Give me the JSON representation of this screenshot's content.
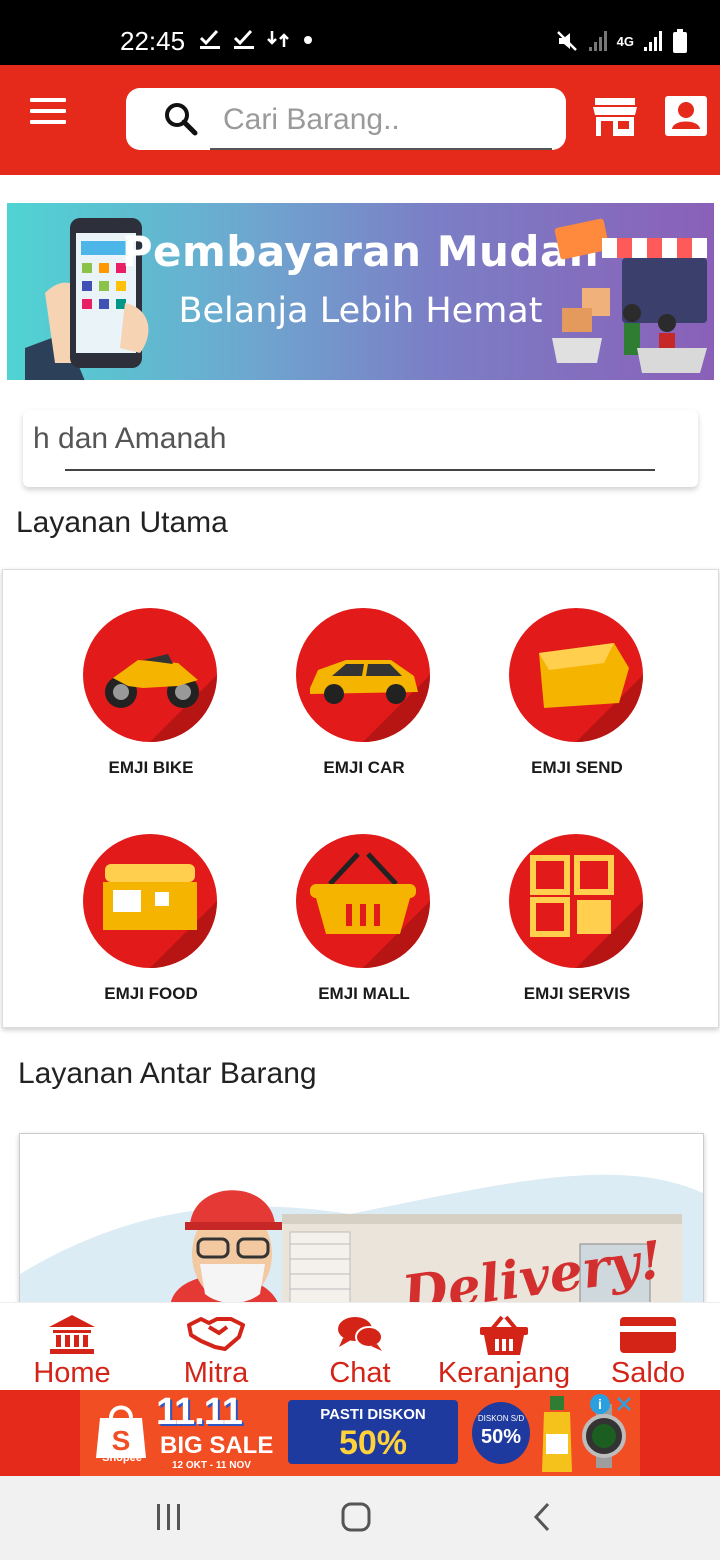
{
  "status_bar": {
    "time": "22:45",
    "network": "4G",
    "icons": [
      "check-download-icon",
      "check-download-icon",
      "sync-icon",
      "dot-icon",
      "mute-icon",
      "signal-icon",
      "signal-icon",
      "battery-icon"
    ]
  },
  "app_bar": {
    "search_placeholder": "Cari Barang..",
    "icons": [
      "menu-icon",
      "search-icon",
      "store-icon",
      "profile-icon"
    ]
  },
  "banner": {
    "title": "Pembayaran Mudah",
    "subtitle": "Belanja Lebih Hemat"
  },
  "marquee": {
    "text": "h dan Amanah"
  },
  "sections": {
    "main_services": "Layanan Utama",
    "delivery": "Layanan Antar Barang"
  },
  "services": [
    {
      "label": "EMJI BIKE",
      "icon": "motorbike-icon"
    },
    {
      "label": "EMJI CAR",
      "icon": "car-icon"
    },
    {
      "label": "EMJI SEND",
      "icon": "package-icon"
    },
    {
      "label": "EMJI FOOD",
      "icon": "food-stall-icon"
    },
    {
      "label": "EMJI MALL",
      "icon": "basket-icon"
    },
    {
      "label": "EMJI SERVIS",
      "icon": "grid-icon"
    }
  ],
  "delivery_card": {
    "sign_text": "Delivery!"
  },
  "bottom_nav": [
    {
      "label": "Home",
      "icon": "bank-icon"
    },
    {
      "label": "Mitra",
      "icon": "handshake-icon"
    },
    {
      "label": "Chat",
      "icon": "chat-icon"
    },
    {
      "label": "Keranjang",
      "icon": "basket-icon"
    },
    {
      "label": "Saldo",
      "icon": "card-icon"
    }
  ],
  "ad": {
    "brand": "Shopee",
    "headline": "11.11",
    "sale": "BIG SALE",
    "dates": "12 OKT - 11 NOV",
    "promo_top": "PASTI DISKON",
    "promo_value": "50%",
    "badge_top": "DISKON S/D",
    "badge_value": "50%"
  },
  "colors": {
    "primary": "#e52a1c",
    "nav_text": "#d42418",
    "banner_start": "#4fd4d2",
    "banner_end": "#8a60b8"
  }
}
